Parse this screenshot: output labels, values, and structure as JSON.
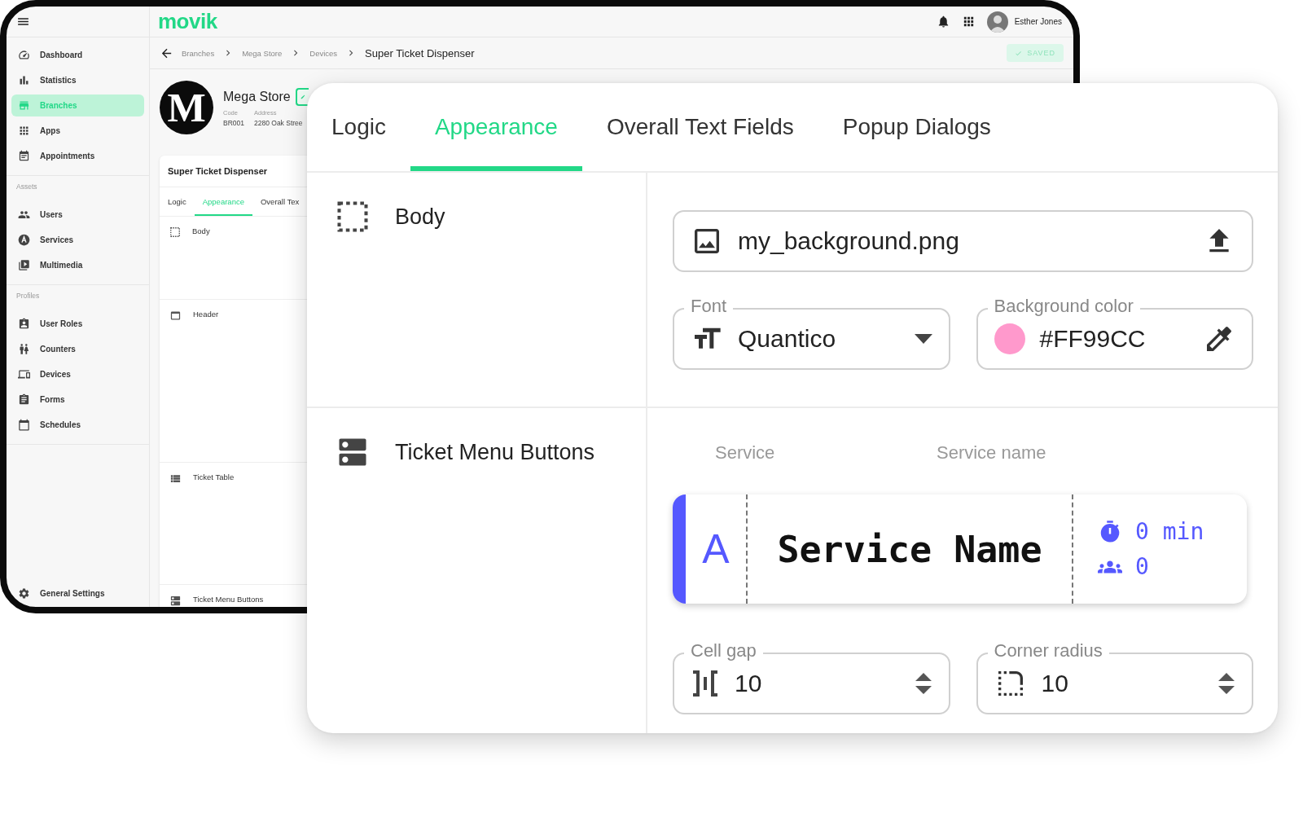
{
  "app": {
    "logo": "movik",
    "user": "Esther Jones",
    "saved": "SAVED"
  },
  "sidebar": {
    "groups": [
      {
        "items": [
          {
            "label": "Dashboard",
            "selected": false
          },
          {
            "label": "Statistics",
            "selected": false
          },
          {
            "label": "Branches",
            "selected": true
          },
          {
            "label": "Apps",
            "selected": false
          },
          {
            "label": "Appointments",
            "selected": false
          }
        ]
      },
      {
        "title": "Assets",
        "items": [
          {
            "label": "Users",
            "selected": false
          },
          {
            "label": "Services",
            "selected": false
          },
          {
            "label": "Multimedia",
            "selected": false
          }
        ]
      },
      {
        "title": "Profiles",
        "items": [
          {
            "label": "User Roles",
            "selected": false
          },
          {
            "label": "Counters",
            "selected": false
          },
          {
            "label": "Devices",
            "selected": false
          },
          {
            "label": "Forms",
            "selected": false
          },
          {
            "label": "Schedules",
            "selected": false
          }
        ]
      }
    ],
    "footer": {
      "label": "General Settings"
    }
  },
  "breadcrumb": [
    "Branches",
    "Mega Store",
    "Devices",
    "Super Ticket Dispenser"
  ],
  "store": {
    "logo": "M",
    "name": "Mega Store",
    "fields": [
      {
        "label": "Code",
        "value": "BR001"
      },
      {
        "label": "Address",
        "value": "2280 Oak Stree"
      }
    ]
  },
  "device": {
    "title": "Super Ticket Dispenser",
    "tabs": [
      {
        "label": "Logic",
        "selected": false
      },
      {
        "label": "Appearance",
        "selected": true
      },
      {
        "label": "Overall Tex",
        "selected": false
      }
    ],
    "sections": [
      "Body",
      "Header",
      "Ticket Table",
      "Ticket Menu Buttons"
    ]
  },
  "panel": {
    "tabs": [
      {
        "label": "Logic",
        "selected": false
      },
      {
        "label": "Appearance",
        "selected": true
      },
      {
        "label": "Overall Text Fields",
        "selected": false
      },
      {
        "label": "Popup Dialogs",
        "selected": false
      }
    ],
    "body": {
      "title": "Body",
      "image_file": "my_background.png",
      "font": {
        "label": "Font",
        "value": "Quantico"
      },
      "background_color": {
        "label": "Background color",
        "value": "#FF99CC",
        "color": "#ff99cc"
      }
    },
    "ticket_menu_buttons": {
      "title": "Ticket Menu Buttons",
      "columns": [
        "Service",
        "Service name"
      ],
      "preview": {
        "letter": "A",
        "name": "Service Name",
        "wait": "0 min",
        "queue": "0"
      },
      "cell_gap": {
        "label": "Cell gap",
        "value": "10"
      },
      "corner_radius": {
        "label": "Corner radius",
        "value": "10"
      }
    }
  }
}
